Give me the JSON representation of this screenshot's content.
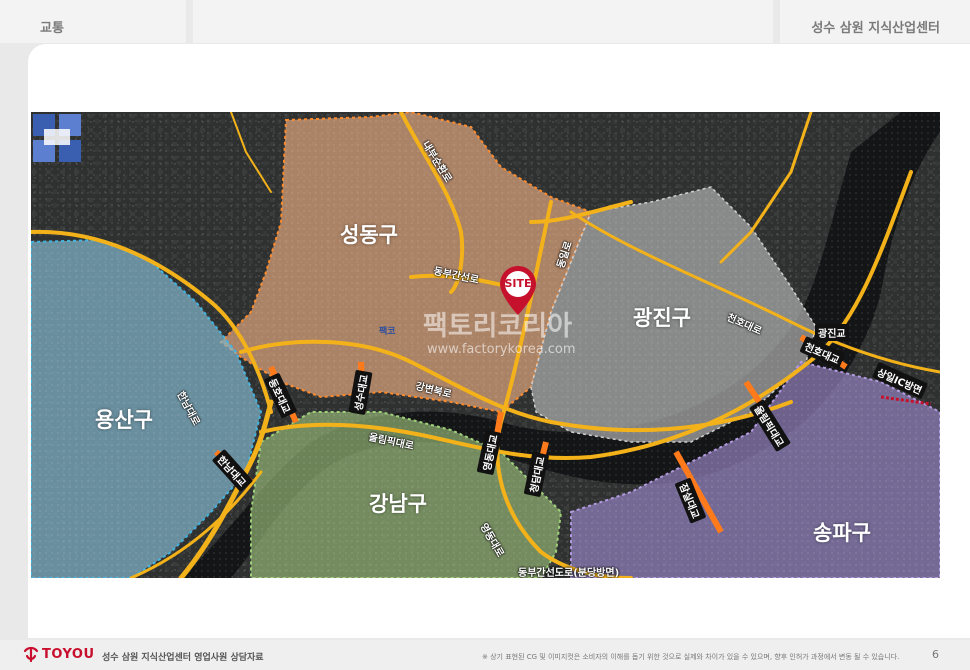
{
  "header": {
    "section": "교통",
    "project": "성수 삼원 지식산업센터"
  },
  "map": {
    "districts": {
      "seongdong": "성동구",
      "gwangjin": "광진구",
      "yongsan": "용산구",
      "gangnam": "강남구",
      "songpa": "송파구"
    },
    "district_colors": {
      "seongdong": "#d9a27a",
      "gwangjin": "#a7a7a7",
      "yongsan": "#7fb3c9",
      "gangnam": "#8fae72",
      "songpa": "#8c7cb6"
    },
    "roads": {
      "naebu": "내부순환로",
      "dongbu": "동부간선로",
      "gangbyeon": "강변북로",
      "olympic": "올림픽대로",
      "hannam": "한남대로",
      "dongil": "동일로",
      "cheonho": "천호대로",
      "yeongdong": "영동대로",
      "dongbu_bundang": "동부간선도로(분당방면)"
    },
    "bridges": {
      "hannam": "한남대교",
      "dongho": "동호대교",
      "seongsu": "성수대교",
      "yeongdong": "영동대교",
      "cheongdam": "청담대교",
      "jamsil": "잠실대교",
      "olympic": "올림픽대교",
      "gwangjin": "광진교",
      "cheonho": "천호대교",
      "sangil": "상일IC방면"
    },
    "site_marker": "SITE",
    "watermark_brand": "팩토리코리아",
    "watermark_url": "www.factorykorea.com",
    "watermark_logo_text": "팩코"
  },
  "footer": {
    "brand": "TOYOU",
    "title": "성수 삼원 지식산업센터  영업사원 상담자료",
    "note": "※ 상기 표현된 CG 및 이미지컷은 소비자의 이해를 돕기 위한 것으로 실제와 차이가 있을 수 있으며, 향후 인허가 과정에서 변동 될 수 있습니다.",
    "page": "6"
  }
}
